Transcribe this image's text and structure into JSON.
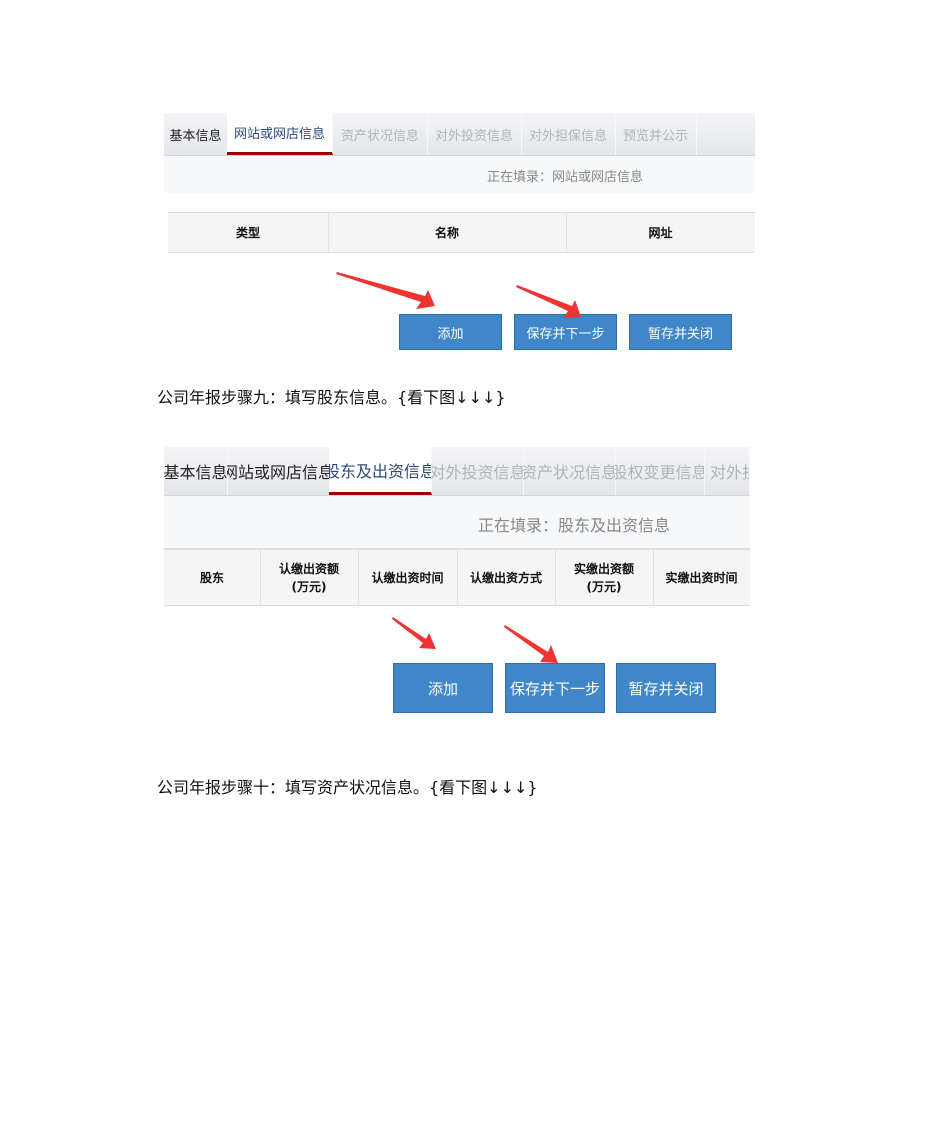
{
  "screenshot1": {
    "tabs": [
      "基本信息",
      "网站或网店信息",
      "资产状况信息",
      "对外投资信息",
      "对外担保信息",
      "预览并公示"
    ],
    "active_tab": "网站或网店信息",
    "status": "正在填录：网站或网店信息",
    "columns": [
      "类型",
      "名称",
      "网址"
    ],
    "buttons": {
      "add": "添加",
      "save_next": "保存并下一步",
      "save_close": "暂存并关闭"
    }
  },
  "step9": "公司年报步骤九：填写股东信息。{看下图↓↓↓}",
  "screenshot2": {
    "tabs": [
      "基本信息",
      "网站或网店信息",
      "股东及出资信息",
      "对外投资信息",
      "资产状况信息",
      "股权变更信息",
      "对外担"
    ],
    "active_tab": "股东及出资信息",
    "status": "正在填录：股东及出资信息",
    "columns": [
      "股东",
      "认缴出资额\n(万元)",
      "认缴出资时间",
      "认缴出资方式",
      "实缴出资额\n(万元)",
      "实缴出资时间"
    ],
    "buttons": {
      "add": "添加",
      "save_next": "保存并下一步",
      "save_close": "暂存并关闭"
    }
  },
  "step10": "公司年报步骤十：填写资产状况信息。{看下图↓↓↓}",
  "colors": {
    "button": "#3f87c8",
    "active_underline": "#990000",
    "arrow": "#ee3333"
  }
}
